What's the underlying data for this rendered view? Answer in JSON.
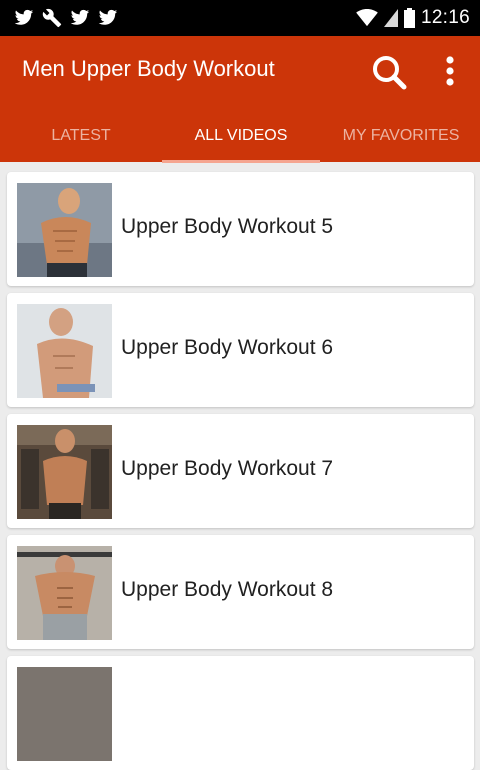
{
  "status_bar": {
    "time": "12:16",
    "left_icons": [
      "twitter-icon",
      "wrench-icon",
      "twitter-icon",
      "twitter-icon"
    ],
    "right_icons": [
      "wifi-icon",
      "signal-icon",
      "battery-icon"
    ]
  },
  "app_bar": {
    "title": "Men Upper Body Workout",
    "background": "#cc3509",
    "actions": [
      "search-icon",
      "more-vert-icon"
    ]
  },
  "tabs": [
    {
      "label": "LATEST",
      "active": false
    },
    {
      "label": "ALL VIDEOS",
      "active": true
    },
    {
      "label": "MY FAVORITES",
      "active": false
    }
  ],
  "videos": [
    {
      "title": "Upper Body Workout 5"
    },
    {
      "title": "Upper Body Workout 6"
    },
    {
      "title": "Upper Body Workout 7"
    },
    {
      "title": "Upper Body Workout 8"
    }
  ]
}
